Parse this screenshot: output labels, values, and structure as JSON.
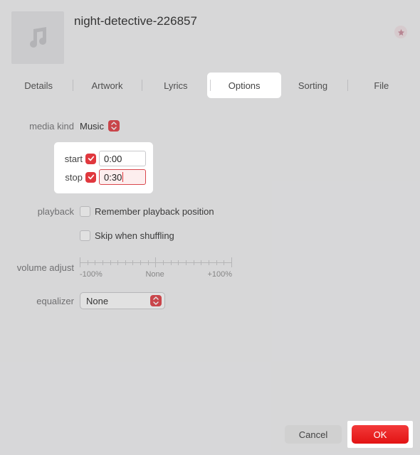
{
  "header": {
    "title": "night-detective-226857"
  },
  "tabs": {
    "details": "Details",
    "artwork": "Artwork",
    "lyrics": "Lyrics",
    "options": "Options",
    "sorting": "Sorting",
    "file": "File"
  },
  "options": {
    "media_kind_label": "media kind",
    "media_kind_value": "Music",
    "start_label": "start",
    "start_value": "0:00",
    "stop_label": "stop",
    "stop_value": "0:30",
    "playback_label": "playback",
    "remember_label": "Remember playback position",
    "skip_label": "Skip when shuffling",
    "volume_adjust_label": "volume adjust",
    "volume_min": "-100%",
    "volume_none": "None",
    "volume_max": "+100%",
    "equalizer_label": "equalizer",
    "equalizer_value": "None"
  },
  "footer": {
    "cancel": "Cancel",
    "ok": "OK"
  }
}
